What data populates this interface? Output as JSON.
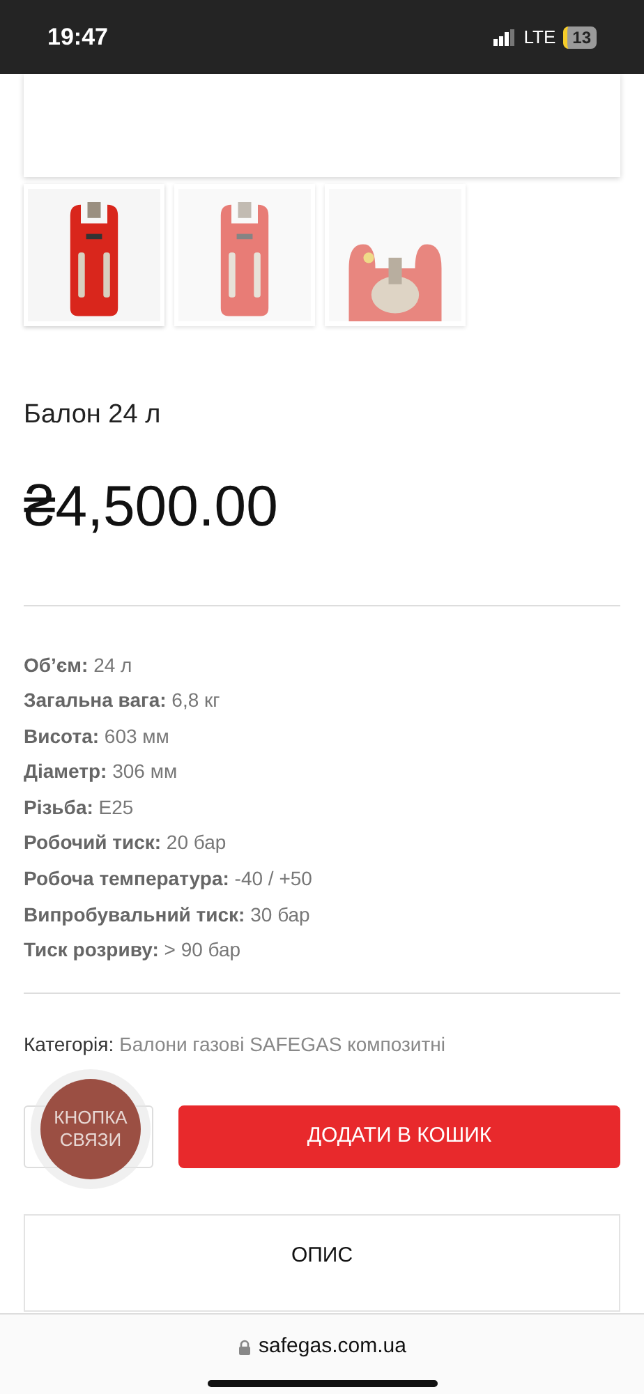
{
  "status_bar": {
    "time": "19:47",
    "network": "LTE",
    "battery": "13"
  },
  "gallery": {
    "thumbnails": [
      {
        "kind": "picture",
        "selected": true
      },
      {
        "kind": "picture",
        "selected": false
      },
      {
        "kind": "picture",
        "selected": false
      }
    ]
  },
  "product": {
    "title": "Балон 24 л",
    "price": "₴4,500.00"
  },
  "specs": [
    "**Об’єм:** 24 л",
    "**Загальна вага:** 6,8 кг",
    "**Висота:** 603 мм",
    "**Діаметр:** 306 мм",
    "**Різьба:** E25",
    "**Робочий тиск:** 20 бар",
    "**Робоча температура:** -40 / +50",
    "**Випробувальний тиск:** 30 бар",
    "**Тиск розриву:** > 90 бар"
  ],
  "category": {
    "label": "Категорія:",
    "value": "Балони газові SAFEGAS композитні"
  },
  "contact_button": {
    "label": "КНОПКА СВЯЗИ"
  },
  "add_to_cart": {
    "label": "ДОДАТИ В КОШИК"
  },
  "tabs": [
    {
      "label": "ОПИС"
    }
  ],
  "browser_bar": {
    "url": "safegas.com.ua"
  }
}
